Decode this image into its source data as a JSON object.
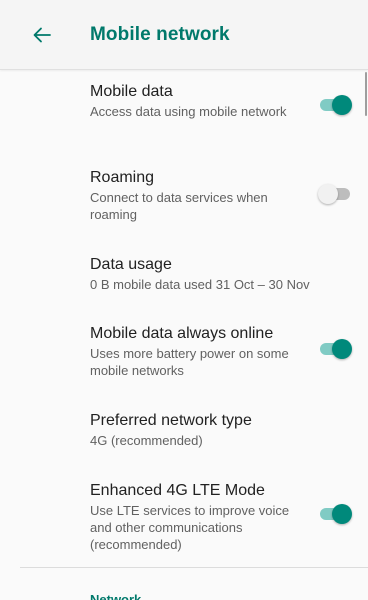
{
  "header": {
    "title": "Mobile network"
  },
  "settings": [
    {
      "title": "Mobile data",
      "subtitle": "Access data using mobile network",
      "toggle": "on"
    },
    {
      "title": "Roaming",
      "subtitle": "Connect to data services when roaming",
      "toggle": "off"
    },
    {
      "title": "Data usage",
      "subtitle": "0 B mobile data used 31 Oct – 30 Nov"
    },
    {
      "title": "Mobile data always online",
      "subtitle": "Uses more battery power on some mobile networks",
      "toggle": "on"
    },
    {
      "title": "Preferred network type",
      "subtitle": "4G (recommended)"
    },
    {
      "title": "Enhanced 4G LTE Mode",
      "subtitle": "Use LTE services to improve voice and other communications (recommended)",
      "toggle": "on"
    }
  ],
  "section": {
    "label": "Network"
  },
  "colors": {
    "accent": "#00796b",
    "toggle_on_thumb": "#00897b",
    "toggle_on_track": "#80cbc4",
    "toggle_off_thumb": "#f1f1f1",
    "toggle_off_track": "#bdbdbd"
  },
  "icons": {
    "back": "arrow-back-icon"
  }
}
